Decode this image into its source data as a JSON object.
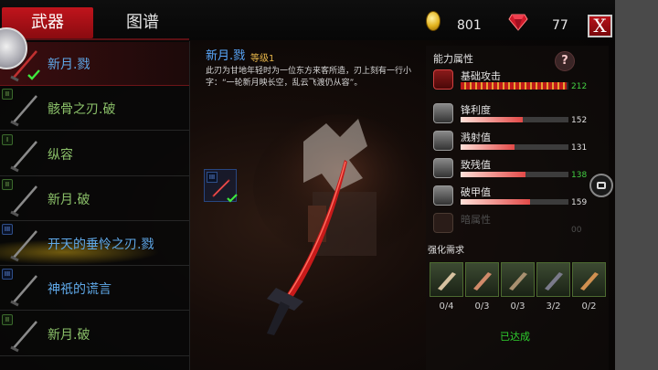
{
  "tabs": {
    "weapons": "武器",
    "atlas": "图谱"
  },
  "currency": {
    "gold": "801",
    "gems": "77"
  },
  "close_label": "X",
  "weapons": [
    {
      "name": "新月.戮",
      "tier": "III",
      "color": "blue",
      "selected": true
    },
    {
      "name": "骸骨之刃.破",
      "tier": "II",
      "color": "green"
    },
    {
      "name": "纵容",
      "tier": "I",
      "color": "green"
    },
    {
      "name": "新月.破",
      "tier": "II",
      "color": "green"
    },
    {
      "name": "开天的垂怜之刃.戮",
      "tier": "III",
      "color": "blue"
    },
    {
      "name": "神祇的谎言",
      "tier": "III",
      "color": "blue"
    },
    {
      "name": "新月.破",
      "tier": "II",
      "color": "green"
    }
  ],
  "detail": {
    "name": "新月.戮",
    "level": "等级1",
    "description": "此刃为甘地年轻时为一位东方来客所造，刃上刻有一行小字：“一轮新月映长空，乱云飞渡仍从容”。",
    "slot_tier": "III"
  },
  "stats": {
    "title": "能力属性",
    "help": "?",
    "items": [
      {
        "label": "基础攻击",
        "value": "212",
        "fill": 0.98,
        "highlight": true,
        "primary": true
      },
      {
        "label": "锋利度",
        "value": "152",
        "fill": 0.58
      },
      {
        "label": "溅射值",
        "value": "131",
        "fill": 0.5
      },
      {
        "label": "致残值",
        "value": "138",
        "fill": 0.6,
        "highlight": true
      },
      {
        "label": "破甲值",
        "value": "159",
        "fill": 0.64
      },
      {
        "label": "暗属性",
        "value": "00",
        "fill": 0,
        "disabled": true
      }
    ]
  },
  "upgrade": {
    "title": "强化需求",
    "materials": [
      {
        "name": "bone-material",
        "count": "0/4"
      },
      {
        "name": "claw-material",
        "count": "0/3"
      },
      {
        "name": "hammer-material",
        "count": "0/3"
      },
      {
        "name": "blade-material",
        "count": "3/2"
      },
      {
        "name": "horn-material",
        "count": "0/2"
      }
    ],
    "status": "已达成"
  }
}
